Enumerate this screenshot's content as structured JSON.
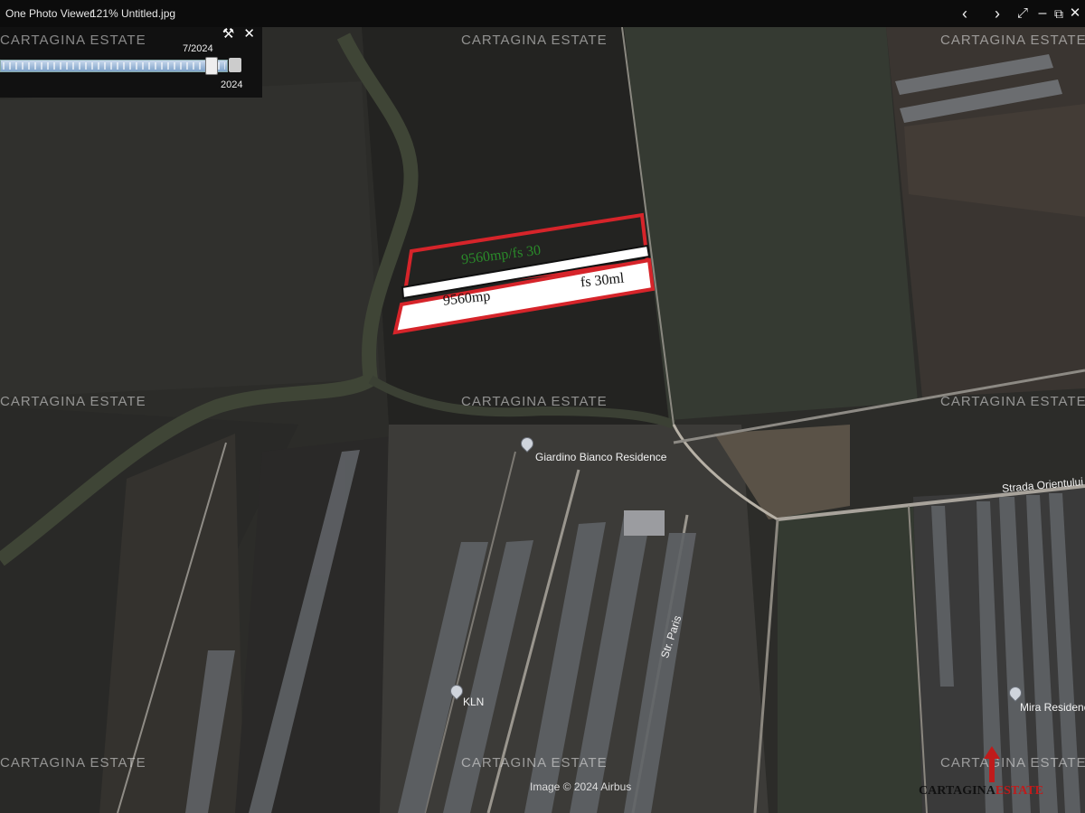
{
  "viewer": {
    "app_name": "One Photo Viewer",
    "zoom": "121%",
    "filename": "Untitled.jpg",
    "controls": [
      "chevron-left-icon",
      "chevron-right-icon",
      "expand-icon",
      "minimize-icon",
      "restore-icon",
      "close-icon"
    ]
  },
  "timeline": {
    "current_label": "7/2024",
    "end_label": "2024",
    "position": 0.93
  },
  "plot": {
    "label_top": "9560mp/fs 30",
    "label_left": "9560mp",
    "label_right": "fs 30ml",
    "outline_color": "#d6242a"
  },
  "places": [
    {
      "name": "Giardino Bianco Residence"
    },
    {
      "name": "KLN"
    },
    {
      "name": "Str. Paris"
    },
    {
      "name": "Strada Orientului"
    },
    {
      "name": "Mira Residence"
    }
  ],
  "credit": "Image © 2024 Airbus",
  "watermark": "CARTAGINA ESTATE",
  "brand": {
    "part1": "CARTAGINA",
    "part2": "ESTATE"
  }
}
